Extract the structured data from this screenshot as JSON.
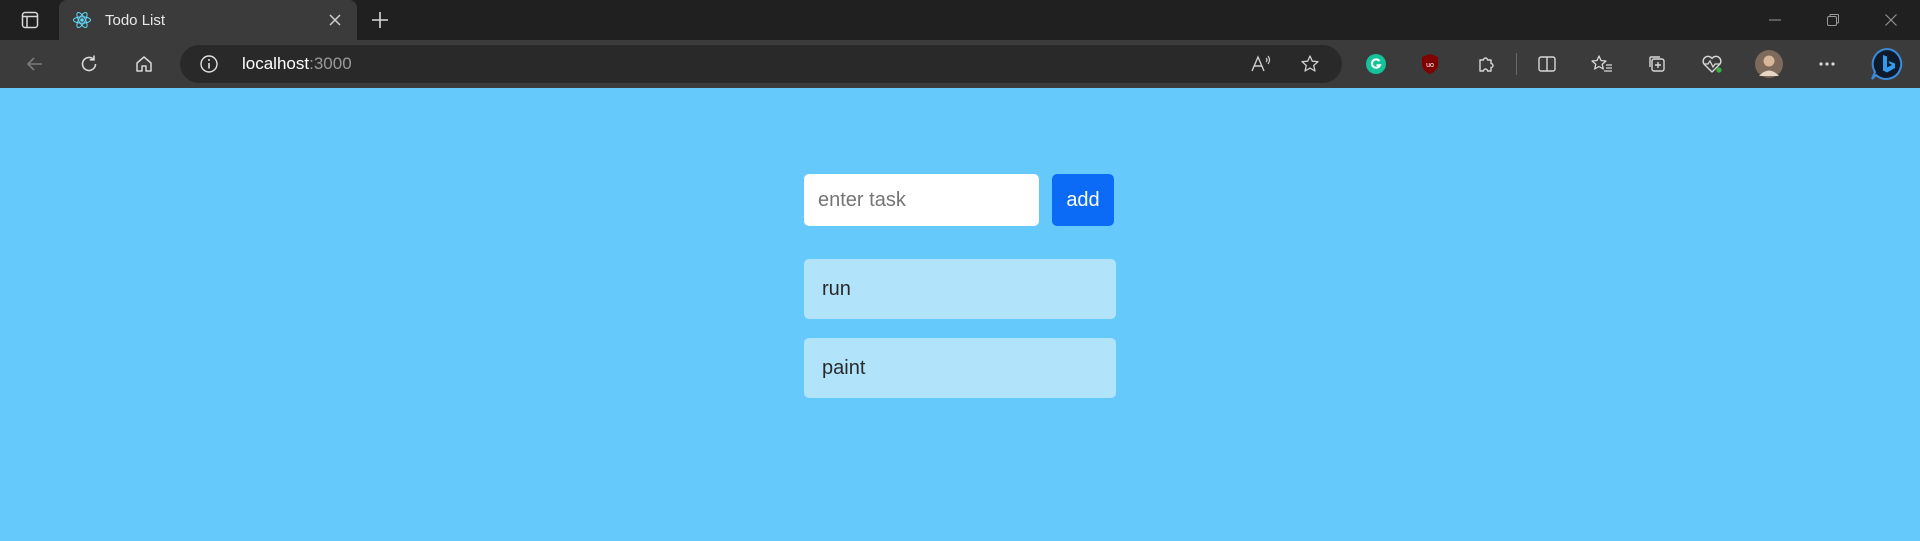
{
  "browser": {
    "tab": {
      "title": "Todo List",
      "favicon": "react-icon"
    },
    "address": {
      "host": "localhost",
      "port": ":3000"
    }
  },
  "app": {
    "input_placeholder": "enter task",
    "input_value": "",
    "add_label": "add",
    "tasks": [
      "run",
      "paint"
    ]
  },
  "colors": {
    "page_background": "#66c9fc",
    "add_button": "#0b6bf6",
    "task_item": "#b1e4fb"
  }
}
